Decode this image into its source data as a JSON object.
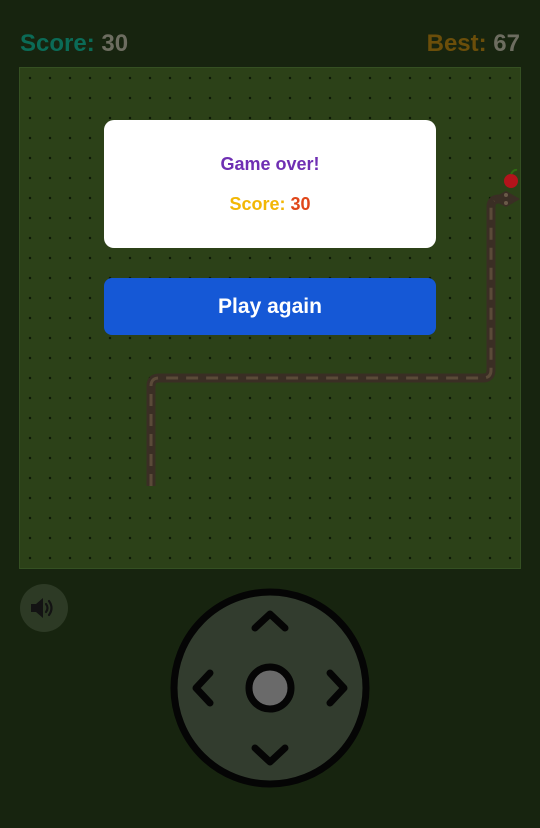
{
  "scoreboard": {
    "score_label": "Score:",
    "score_value": "30",
    "best_label": "Best:",
    "best_value": "67"
  },
  "dialog": {
    "title": "Game over!",
    "score_label": "Score:",
    "score_value": "30"
  },
  "play_again_label": "Play again",
  "controls": {
    "sound_icon": "speaker-volume-icon",
    "dpad_icons": [
      "arrow-up-icon",
      "arrow-left-icon",
      "center-button",
      "arrow-right-icon",
      "arrow-down-icon"
    ]
  },
  "colors": {
    "board": "#2c4118",
    "snake": "#3a2e24",
    "apple": "#b3131b",
    "dialog_title": "#6f2fb3",
    "play_button": "#1558d6"
  }
}
